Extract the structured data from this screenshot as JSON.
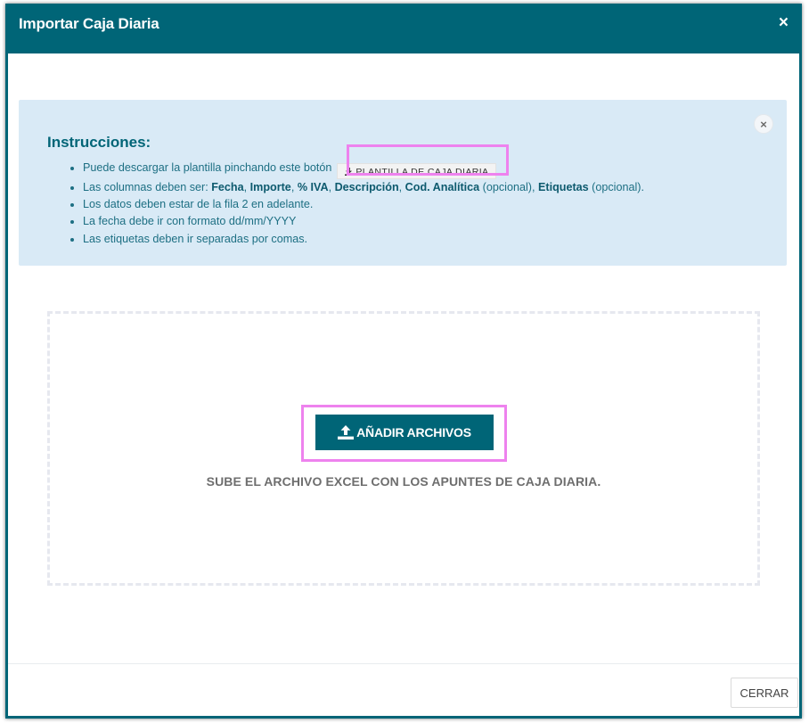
{
  "modal": {
    "title": "Importar Caja Diaria",
    "close_icon": "×"
  },
  "instructions": {
    "heading": "Instrucciones:",
    "close_icon": "×",
    "item1_text": "Puede descargar la plantilla pinchando este botón",
    "template_button_label": "PLANTILLA DE CAJA DIARIA",
    "item2": {
      "prefix": "Las columnas deben ser: ",
      "col1": "Fecha",
      "sep1": ", ",
      "col2": "Importe",
      "sep2": ", ",
      "col3": "% IVA",
      "sep3": ", ",
      "col4": "Descripción",
      "sep4": ", ",
      "col5": "Cod. Analítica",
      "opt1": " (opcional), ",
      "col6": "Etiquetas",
      "opt2": " (opcional)."
    },
    "item3": "Los datos deben estar de la fila 2 en adelante.",
    "item4": "La fecha debe ir con formato dd/mm/YYYY",
    "item5": "Las etiquetas deben ir separadas por comas."
  },
  "upload": {
    "button_label": "AÑADIR ARCHIVOS",
    "hint": "SUBE EL ARCHIVO EXCEL CON LOS APUNTES DE CAJA DIARIA."
  },
  "footer": {
    "close_label": "CERRAR"
  },
  "icons": {
    "download": "download-icon",
    "upload": "upload-icon"
  },
  "colors": {
    "primary": "#006577",
    "alert_bg": "#d9eaf6",
    "highlight": "#ee82ee"
  }
}
